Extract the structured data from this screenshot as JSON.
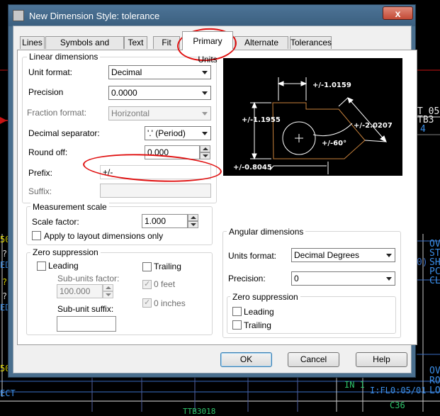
{
  "dialog": {
    "title": "New Dimension Style: tolerance",
    "close_label": "x"
  },
  "tabs": [
    {
      "label": "Lines",
      "active": false
    },
    {
      "label": "Symbols and Arrows",
      "active": false
    },
    {
      "label": "Text",
      "active": false
    },
    {
      "label": "Fit",
      "active": false
    },
    {
      "label": "Primary Units",
      "active": true
    },
    {
      "label": "Alternate Units",
      "active": false
    },
    {
      "label": "Tolerances",
      "active": false
    }
  ],
  "linear": {
    "group_title": "Linear dimensions",
    "unit_format_label": "Unit format:",
    "unit_format_value": "Decimal",
    "precision_label": "Precision",
    "precision_value": "0.0000",
    "fraction_format_label": "Fraction format:",
    "fraction_format_value": "Horizontal",
    "decimal_separator_label": "Decimal separator:",
    "decimal_separator_value": "'.' (Period)",
    "round_off_label": "Round off:",
    "round_off_value": "0.000",
    "prefix_label": "Prefix:",
    "prefix_value": "+/-",
    "suffix_label": "Suffix:",
    "suffix_value": ""
  },
  "measurement": {
    "group_title": "Measurement scale",
    "scale_factor_label": "Scale factor:",
    "scale_factor_value": "1.000",
    "apply_layout_label": "Apply to layout dimensions only",
    "apply_layout_checked": false
  },
  "zero_suppression_linear": {
    "group_title": "Zero suppression",
    "leading_label": "Leading",
    "leading_checked": false,
    "trailing_label": "Trailing",
    "trailing_checked": false,
    "subunits_factor_label": "Sub-units factor:",
    "subunits_factor_value": "100.000",
    "zero_feet_label": "0 feet",
    "zero_feet_checked": true,
    "subunit_suffix_label": "Sub-unit suffix:",
    "subunit_suffix_value": "",
    "zero_inches_label": "0 inches",
    "zero_inches_checked": true
  },
  "angular": {
    "group_title": "Angular dimensions",
    "units_format_label": "Units format:",
    "units_format_value": "Decimal Degrees",
    "precision_label": "Precision:",
    "precision_value": "0",
    "zero_group_title": "Zero suppression",
    "leading_label": "Leading",
    "leading_checked": false,
    "trailing_label": "Trailing",
    "trailing_checked": false
  },
  "preview": {
    "dim_top": "+/-1.0159",
    "dim_left": "+/-1.1955",
    "dim_right": "+/-2.0207",
    "dim_angle": "+/-60°",
    "dim_bottom": "+/-0.8045"
  },
  "buttons": {
    "ok": "OK",
    "cancel": "Cancel",
    "help": "Help"
  },
  "background_cad": {
    "right_top_1": "T 05",
    "right_top_2": "TB3",
    "right_top_3": "4",
    "right_mid_1": "OV",
    "right_mid_2": "ST",
    "right_mid_3": "SH",
    "right_mid_4": "PC",
    "right_mid_5": "CL",
    "right_low_1": "OV",
    "right_low_2": "RO",
    "right_low_3": "LO",
    "right_paren": "0)",
    "bottom_1": "IN 1",
    "bottom_2": "I:FL0:05/01",
    "bottom_3": "C36",
    "bottom_4": "TTB3018",
    "left_1": "50",
    "left_2": "?",
    "left_3": "ED",
    "left_4": "?",
    "left_5": "?",
    "left_6": "ED",
    "left_7": "50",
    "left_8": "ECT"
  },
  "colors": {
    "cad_background": "#000000",
    "cad_red_line": "#c81414",
    "cad_yellow": "#e8e000",
    "cad_blue": "#3a8ee8",
    "cad_green": "#2ec46a",
    "annotation_red": "#e01010"
  }
}
